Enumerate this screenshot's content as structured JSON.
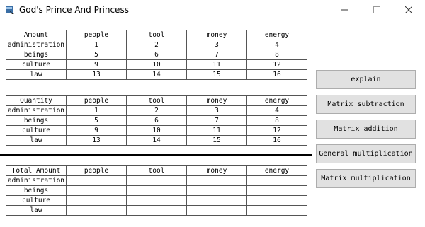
{
  "window": {
    "title": "God's Prince And Princess"
  },
  "columns": [
    "people",
    "tool",
    "money",
    "energy"
  ],
  "rows": [
    "administration",
    "beings",
    "culture",
    "law"
  ],
  "amount_table": {
    "corner": "Amount",
    "values": [
      [
        "1",
        "2",
        "3",
        "4"
      ],
      [
        "5",
        "6",
        "7",
        "8"
      ],
      [
        "9",
        "10",
        "11",
        "12"
      ],
      [
        "13",
        "14",
        "15",
        "16"
      ]
    ]
  },
  "quantity_table": {
    "corner": "Quantity",
    "values": [
      [
        "1",
        "2",
        "3",
        "4"
      ],
      [
        "5",
        "6",
        "7",
        "8"
      ],
      [
        "9",
        "10",
        "11",
        "12"
      ],
      [
        "13",
        "14",
        "15",
        "16"
      ]
    ]
  },
  "total_table": {
    "corner": "Total Amount",
    "values": [
      [
        "",
        "",
        "",
        ""
      ],
      [
        "",
        "",
        "",
        ""
      ],
      [
        "",
        "",
        "",
        ""
      ],
      [
        "",
        "",
        "",
        ""
      ]
    ]
  },
  "buttons": {
    "explain": "explain",
    "subtraction": "Matrix subtraction",
    "addition": "Matrix addition",
    "general_mult": "General multiplication",
    "matrix_mult": "Matrix multiplication"
  }
}
